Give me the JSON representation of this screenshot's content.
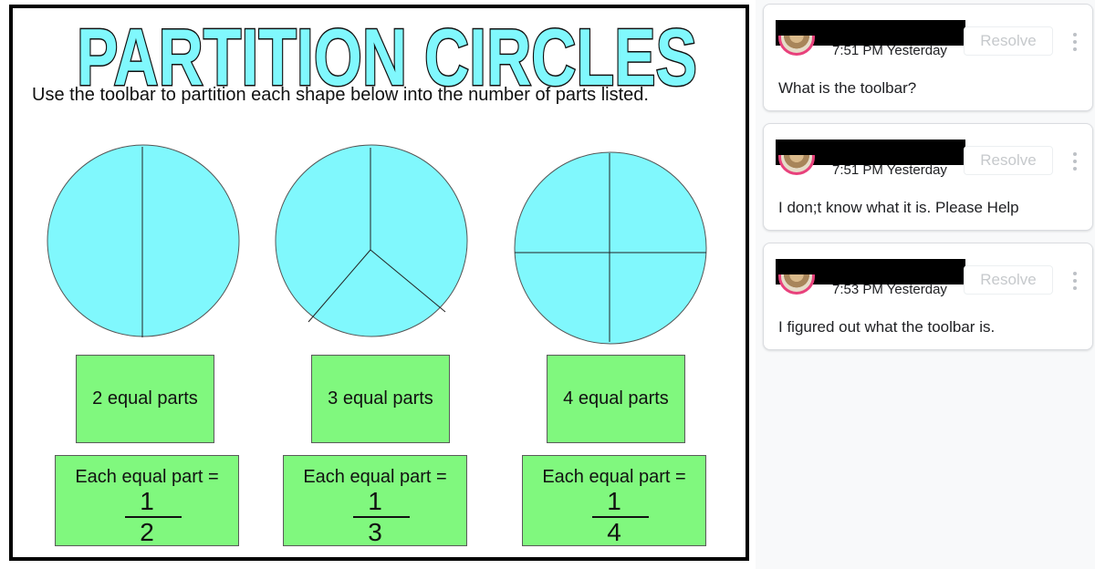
{
  "slide": {
    "title": "PARTITION CIRCLES",
    "instructions": "Use the toolbar to partition each shape below into the number of parts listed.",
    "colors": {
      "circle_fill": "#80f8fd",
      "box_fill": "#80f87e",
      "title_fill": "#80f8fd"
    },
    "shapes": [
      {
        "parts_label": "2 equal parts",
        "fraction_label": "Each equal part =",
        "numerator": "1",
        "denominator": "2"
      },
      {
        "parts_label": "3 equal parts",
        "fraction_label": "Each equal part =",
        "numerator": "1",
        "denominator": "3"
      },
      {
        "parts_label": "4 equal parts",
        "fraction_label": "Each equal part =",
        "numerator": "1",
        "denominator": "4"
      }
    ]
  },
  "comments": [
    {
      "time": "7:51 PM Yesterday",
      "resolve_label": "Resolve",
      "text": "What is the toolbar?",
      "icon": "more-vert-icon"
    },
    {
      "time": "7:51 PM Yesterday",
      "resolve_label": "Resolve",
      "text": "I don;t know what it is. Please Help",
      "icon": "more-vert-icon"
    },
    {
      "time": "7:53 PM Yesterday",
      "resolve_label": "Resolve",
      "text": "I figured out what the toolbar is.",
      "icon": "more-vert-icon"
    }
  ]
}
